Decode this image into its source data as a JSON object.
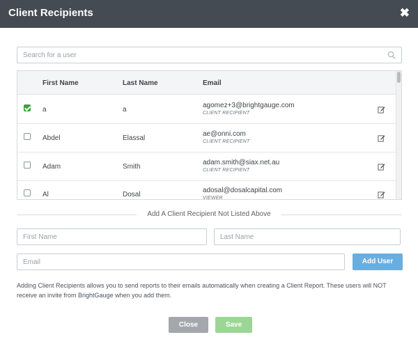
{
  "header": {
    "title": "Client Recipients",
    "close_label": "✖"
  },
  "search": {
    "placeholder": "Search for a user"
  },
  "table": {
    "columns": [
      "First Name",
      "Last Name",
      "Email"
    ],
    "rows": [
      {
        "checked": true,
        "first": "a",
        "last": "a",
        "email": "agomez+3@brightgauge.com",
        "role": "CLIENT RECIPIENT"
      },
      {
        "checked": false,
        "first": "Abdel",
        "last": "Elassal",
        "email": "ae@onni.com",
        "role": "CLIENT RECIPIENT"
      },
      {
        "checked": false,
        "first": "Adam",
        "last": "Smith",
        "email": "adam.smith@siax.net.au",
        "role": "CLIENT RECIPIENT"
      },
      {
        "checked": false,
        "first": "Al",
        "last": "Dosal",
        "email": "adosal@dosalcapital.com",
        "role": "VIEWER"
      }
    ]
  },
  "add_section": {
    "title": "Add A Client Recipient Not Listed Above",
    "first_name_placeholder": "First Name",
    "last_name_placeholder": "Last Name",
    "email_placeholder": "Email",
    "add_button": "Add User"
  },
  "info_text": "Adding Client Recipients allows you to send reports to their emails automatically when creating a Client Report. These users will NOT receive an invite from BrightGauge when you add them.",
  "footer": {
    "close_button": "Close",
    "save_button": "Save"
  },
  "colors": {
    "header_bg": "#444b53",
    "check_green": "#37a63b",
    "add_blue": "#6aaee0",
    "close_gray": "#a4a7ab",
    "save_green": "#9bd695"
  },
  "icons": {
    "search": "search-icon",
    "edit": "edit-icon",
    "close": "close-icon"
  }
}
